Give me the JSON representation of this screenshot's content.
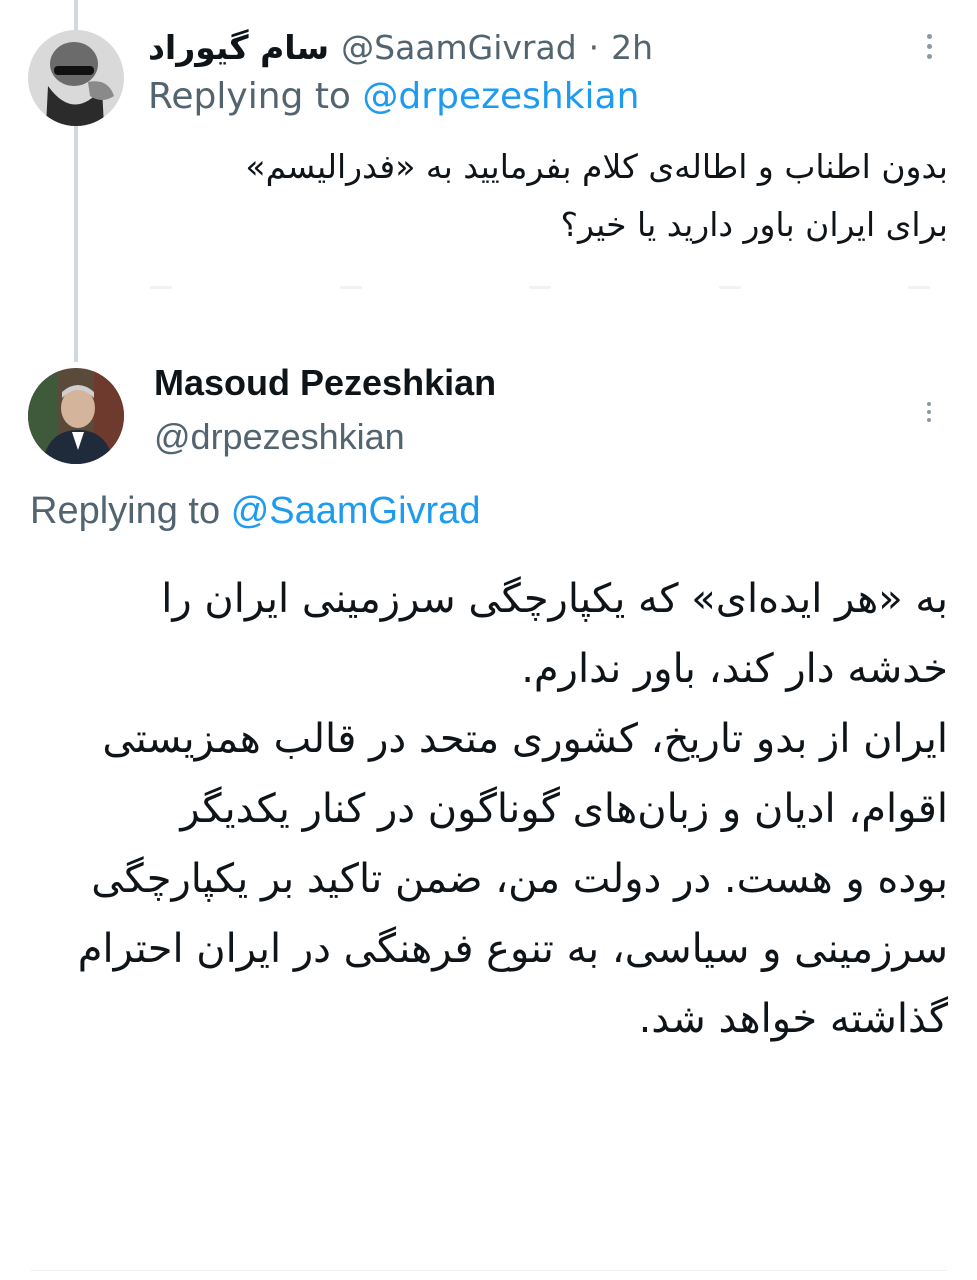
{
  "reply_tweet": {
    "display_name": "سام گیوراد",
    "handle": "@SaamGivrad",
    "separator": "·",
    "time": "2h",
    "replying_prefix": "Replying to",
    "replying_handle": "@drpezeshkian",
    "text_lines": [
      "بدون اطناب و اطاله‌ی کلام بفرمایید به «فدرالیسم»",
      "برای ایران باور دارید یا خیر؟"
    ],
    "avatar_icon": "profile-photo-bald-man-sunglasses"
  },
  "main_tweet": {
    "display_name": "Masoud Pezeshkian",
    "handle": "@drpezeshkian",
    "replying_prefix": "Replying to",
    "replying_handle": "@SaamGivrad",
    "paragraphs": [
      {
        "lines": [
          "به «هر ایده‌ای» که یکپارچگی سرزمینی ایران را",
          "خدشه دار کند، باور ندارم."
        ]
      },
      {
        "lines": [
          "ایران از بدو تاریخ، کشوری متحد در قالب همزیستی",
          "اقوام، ادیان و زبان‌های گوناگون در کنار یکدیگر",
          "بوده و هست. در دولت من، ضمن تاکید بر یکپارچگی",
          "سرزمینی و سیاسی، به تنوع فرهنگی در ایران احترام",
          "گذاشته خواهد شد."
        ]
      }
    ],
    "avatar_icon": "profile-photo-man-in-suit"
  },
  "colors": {
    "text": "#0f1419",
    "muted": "#536471",
    "link": "#1d9bf0",
    "thread_line": "#cfd9de"
  }
}
